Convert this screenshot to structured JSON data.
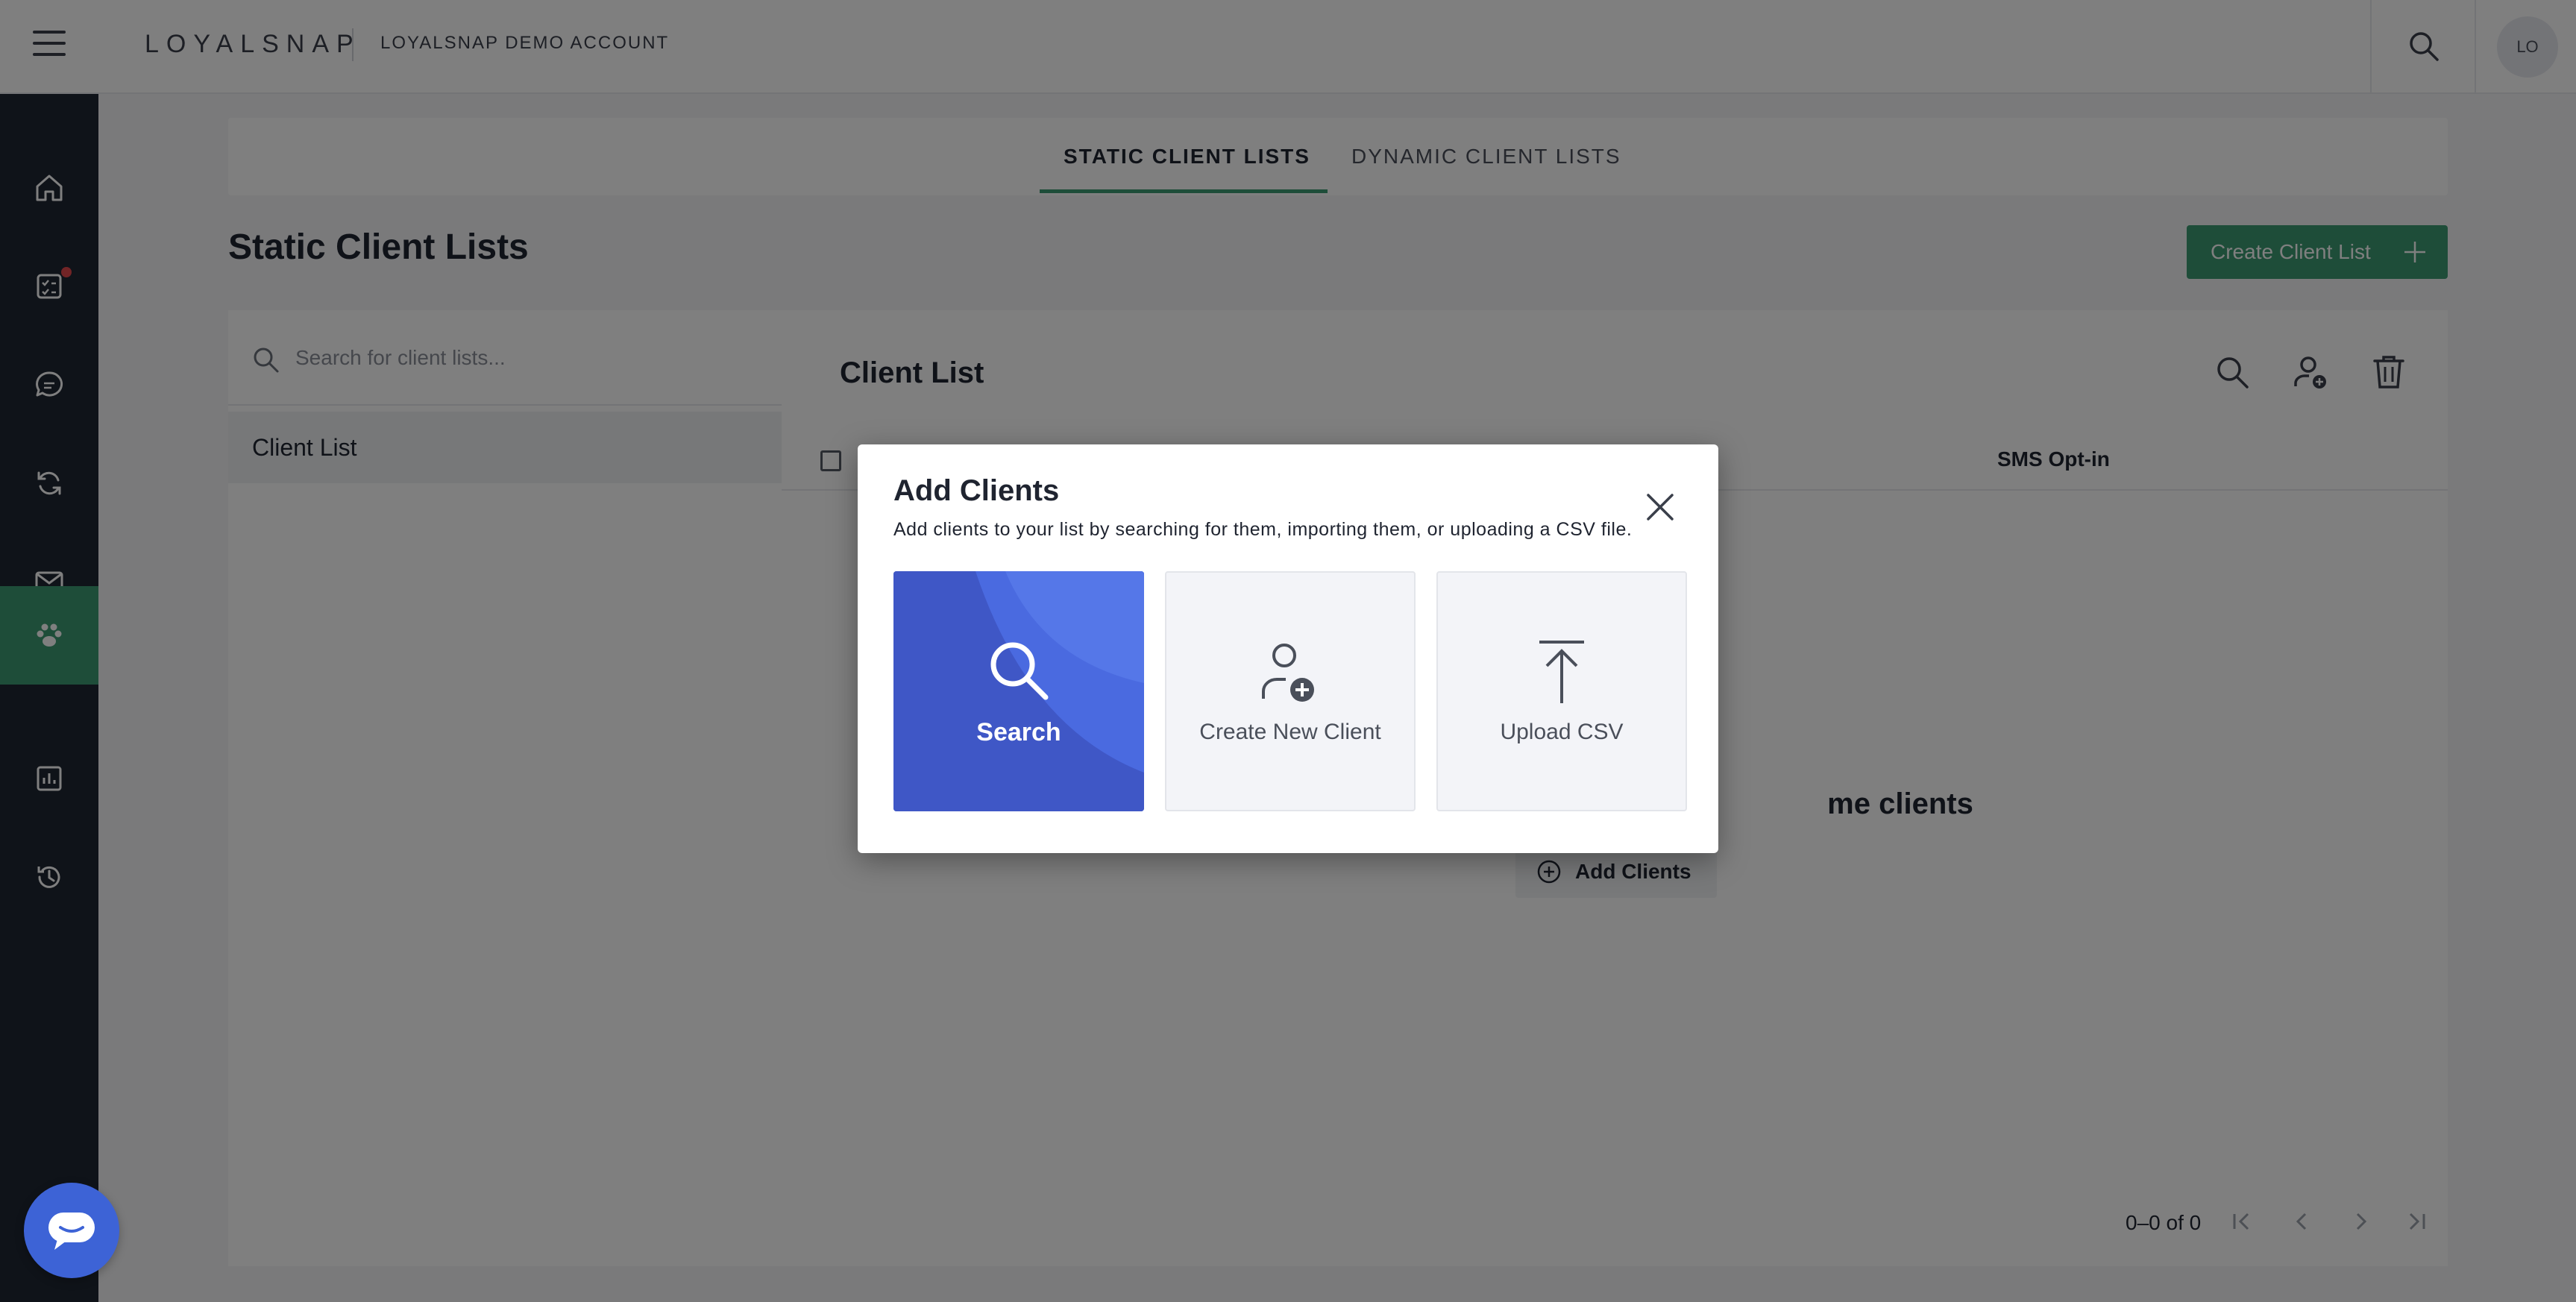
{
  "topbar": {
    "brand": "LOYALSNAP",
    "account": "LOYALSNAP DEMO ACCOUNT",
    "avatar_initials": "LO"
  },
  "sidebar": {
    "items": [
      {
        "icon": "home-icon"
      },
      {
        "icon": "tasks-icon",
        "badge": true
      },
      {
        "icon": "chat-icon"
      },
      {
        "icon": "sync-icon"
      },
      {
        "icon": "mail-icon"
      },
      {
        "icon": "paw-icon",
        "active": true
      },
      {
        "icon": "chart-icon"
      },
      {
        "icon": "history-icon"
      }
    ],
    "active_color": "#3d9a73",
    "bg_color": "#1f2633"
  },
  "tabs": {
    "static": "STATIC CLIENT LISTS",
    "dynamic": "DYNAMIC CLIENT LISTS"
  },
  "page": {
    "title": "Static Client Lists",
    "create_button": "Create Client List"
  },
  "left_panel": {
    "search_placeholder": "Search for client lists...",
    "items": [
      "Client List"
    ]
  },
  "right_panel": {
    "title": "Client List",
    "column_sms": "SMS Opt-in",
    "empty_text_visible": "me clients",
    "add_clients": "Add Clients",
    "pagination": "0–0 of 0"
  },
  "modal": {
    "title": "Add Clients",
    "subtitle": "Add clients to your list by searching for them, importing them, or uploading a CSV file.",
    "options": {
      "search": "Search",
      "create": "Create New Client",
      "upload": "Upload CSV"
    },
    "search_color": "#3f5fd0"
  }
}
